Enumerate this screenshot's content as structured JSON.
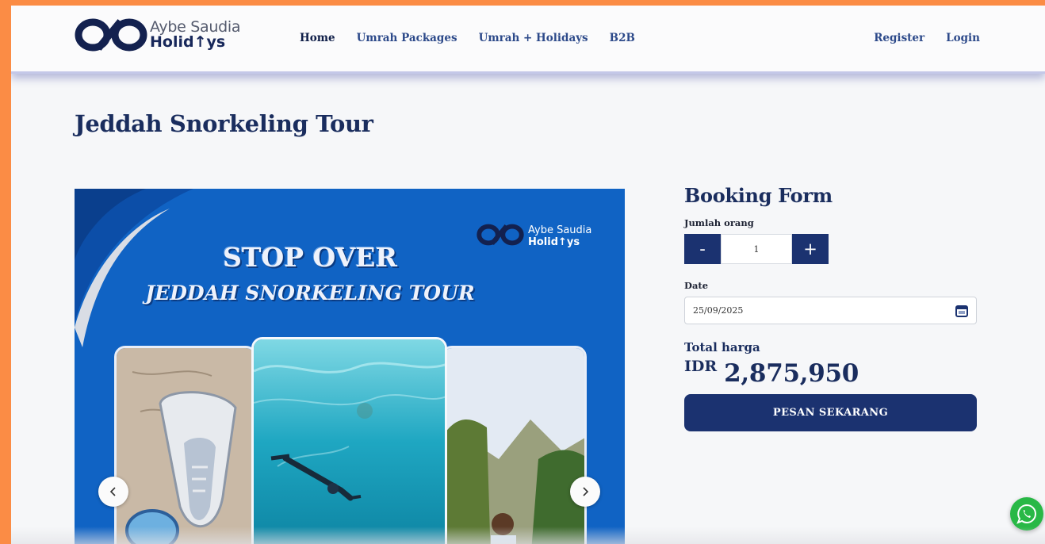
{
  "brand": {
    "line1": "Aybe Saudia",
    "line2": "Holid↑ys"
  },
  "nav": {
    "items": [
      {
        "label": "Home",
        "active": true
      },
      {
        "label": "Umrah Packages"
      },
      {
        "label": "Umrah + Holidays"
      },
      {
        "label": "B2B"
      }
    ],
    "register": "Register",
    "login": "Login"
  },
  "page": {
    "title": "Jeddah Snorkeling Tour"
  },
  "banner": {
    "title": "STOP OVER",
    "subtitle": "JEDDAH SNORKELING TOUR",
    "logo_line1": "Aybe Saudia",
    "logo_line2": "Holid↑ys"
  },
  "booking": {
    "heading": "Booking Form",
    "people_label": "Jumlah orang",
    "minus": "-",
    "plus": "+",
    "quantity": "1",
    "date_label": "Date",
    "date_value": "25/09/2025",
    "total_label": "Total harga",
    "currency": "IDR",
    "amount": "2,875,950",
    "order_button": "PESAN SEKARANG"
  },
  "icons": {
    "calendar": "calendar-icon",
    "prev": "chevron-left-icon",
    "next": "chevron-right-icon",
    "whatsapp": "whatsapp-icon"
  },
  "colors": {
    "primary": "#1b3270",
    "banner": "#1063c4",
    "frame": "#fb8c45",
    "whatsapp": "#28b846"
  }
}
